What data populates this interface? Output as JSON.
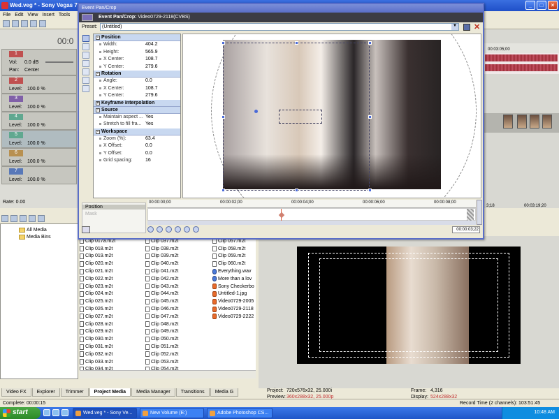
{
  "main_window": {
    "title": "Wed.veg * - Sony Vegas 7",
    "min": "_",
    "max": "□",
    "close": "×"
  },
  "menubar": [
    "File",
    "Edit",
    "View",
    "Insert",
    "Tools"
  ],
  "track_panel": {
    "timecode": "00:0",
    "tracks": [
      {
        "num": "1",
        "color": "#c05050",
        "level": "Vol:",
        "value": "0.0 dB",
        "pan_label": "Pan:",
        "pan_value": "Center"
      },
      {
        "num": "2",
        "color": "#c05050",
        "level": "Level:",
        "value": "100.0 %"
      },
      {
        "num": "3",
        "color": "#8060a8",
        "level": "Level:",
        "value": "100.0 %"
      },
      {
        "num": "4",
        "color": "#60a890",
        "level": "Level:",
        "value": "100.0 %"
      },
      {
        "num": "5",
        "color": "#60a890",
        "level": "Level:",
        "value": "100.0 %"
      },
      {
        "num": "6",
        "color": "#b89050",
        "level": "Level:",
        "value": "100.0 %"
      },
      {
        "num": "7",
        "color": "#5878b8",
        "level": "Level:",
        "value": "100.0 %"
      }
    ],
    "rate_label": "Rate: 0.00"
  },
  "timeline_right": {
    "ruler_time": "00:03:05;00",
    "time_a": "3;18",
    "time_b": "00:03:19;20"
  },
  "dialog": {
    "title": "Event Pan/Crop",
    "subtitle_label": "Event Pan/Crop:",
    "subtitle_value": "Video0729-2118(CVBS)",
    "preset_label": "Preset:",
    "preset_value": "(Untitled)",
    "sections": {
      "position": {
        "header": "Position",
        "rows": [
          {
            "label": "Width:",
            "value": "404.2"
          },
          {
            "label": "Height:",
            "value": "565.9"
          },
          {
            "label": "X Center:",
            "value": "108.7"
          },
          {
            "label": "Y Center:",
            "value": "279.6"
          }
        ]
      },
      "rotation": {
        "header": "Rotation",
        "rows": [
          {
            "label": "Angle:",
            "value": "0.0"
          },
          {
            "label": "X Center:",
            "value": "108.7"
          },
          {
            "label": "Y Center:",
            "value": "279.6"
          }
        ]
      },
      "keyframe": {
        "header": "Keyframe interpolation"
      },
      "source": {
        "header": "Source",
        "rows": [
          {
            "label": "Maintain aspect ...",
            "value": "Yes"
          },
          {
            "label": "Stretch to fill fra...",
            "value": "Yes"
          }
        ]
      },
      "workspace": {
        "header": "Workspace",
        "rows": [
          {
            "label": "Zoom (%):",
            "value": "63.4"
          },
          {
            "label": "X Offset:",
            "value": "0.0"
          },
          {
            "label": "Y Offset:",
            "value": "0.0"
          },
          {
            "label": "Grid spacing:",
            "value": "16"
          }
        ]
      }
    },
    "keyframe_track": {
      "labels": [
        "Position",
        "Mask"
      ],
      "ruler": [
        "00:00:00;00",
        "00:00:02;00",
        "00:00:04;00",
        "00:00:06;00",
        "00:00:08;00"
      ],
      "time": "00:00:03;22"
    }
  },
  "explorer": {
    "tree": [
      "All Media",
      "Media Bins"
    ]
  },
  "file_columns": [
    [
      "Clip 017a.m2t",
      "Clip 018.m2t",
      "Clip 019.m2t",
      "Clip 020.m2t",
      "Clip 021.m2t",
      "Clip 022.m2t",
      "Clip 023.m2t",
      "Clip 024.m2t",
      "Clip 025.m2t",
      "Clip 026.m2t",
      "Clip 027.m2t",
      "Clip 028.m2t",
      "Clip 029.m2t",
      "Clip 030.m2t",
      "Clip 031.m2t",
      "Clip 032.m2t",
      "Clip 033.m2t",
      "Clip 034.m2t"
    ],
    [
      "Clip 037.m2t",
      "Clip 038.m2t",
      "Clip 039.m2t",
      "Clip 040.m2t",
      "Clip 041.m2t",
      "Clip 042.m2t",
      "Clip 043.m2t",
      "Clip 044.m2t",
      "Clip 045.m2t",
      "Clip 046.m2t",
      "Clip 047.m2t",
      "Clip 048.m2t",
      "Clip 049.m2t",
      "Clip 050.m2t",
      "Clip 051.m2t",
      "Clip 052.m2t",
      "Clip 053.m2t",
      "Clip 054.m2t"
    ],
    [
      "Clip 057.m2t",
      "Clip 058.m2t",
      "Clip 059.m2t",
      "Clip 060.m2t",
      "Everything.wav",
      "More than a lov",
      "Sony Checkerbo",
      "Untitled-1.jpg",
      "Video0729-2005",
      "Video0729-2118",
      "Video0729-2222"
    ]
  ],
  "tabs": [
    "Video FX",
    "Explorer",
    "Trimmer",
    "Project Media",
    "Media Manager",
    "Transitions",
    "Media G"
  ],
  "preview_info": {
    "project_label": "Project:",
    "project_value": "720x576x32, 25.000i",
    "preview_label": "Preview:",
    "preview_value": "360x288x32, 25.000p",
    "frame_label": "Frame:",
    "frame_value": "4,316",
    "display_label": "Display:",
    "display_value": "524x288x32"
  },
  "statusbar": {
    "left": "Complete: 00:00:15",
    "right": "Record Time (2 channels): 103:51:45"
  },
  "taskbar": {
    "start": "start",
    "tasks": [
      "Wed.veg * - Sony Ve...",
      "New Volume (E:)",
      "Adobe Photoshop CS..."
    ],
    "clock": "10:48 AM"
  }
}
